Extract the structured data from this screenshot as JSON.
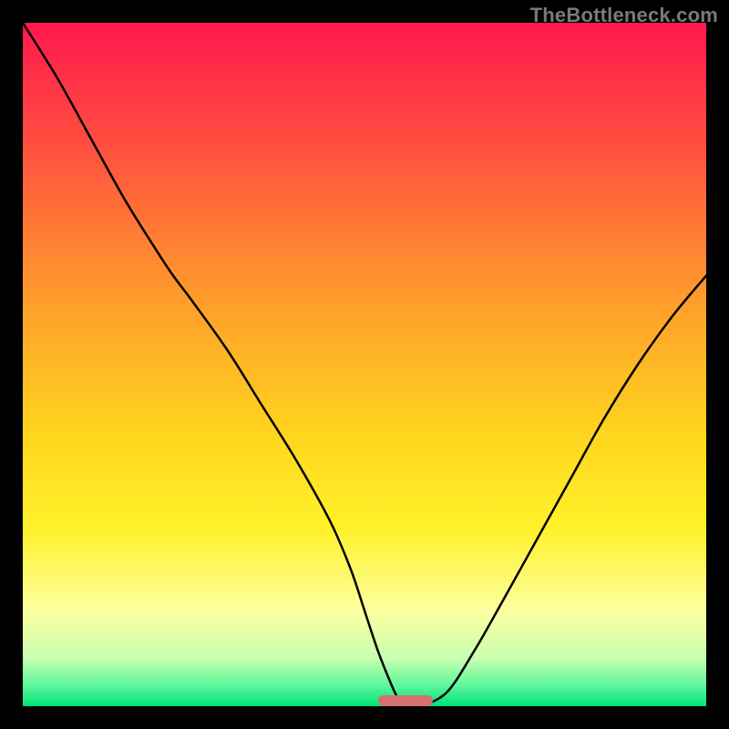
{
  "watermark": "TheBottleneck.com",
  "chart_data": {
    "type": "line",
    "title": "",
    "xlabel": "",
    "ylabel": "",
    "xlim": [
      0,
      100
    ],
    "ylim": [
      0,
      100
    ],
    "grid": false,
    "background_gradient": {
      "stops": [
        {
          "offset": 0,
          "color": "#ff184e"
        },
        {
          "offset": 18,
          "color": "#ff4f3f"
        },
        {
          "offset": 40,
          "color": "#ff9b2c"
        },
        {
          "offset": 60,
          "color": "#ffd41e"
        },
        {
          "offset": 74,
          "color": "#fff22a"
        },
        {
          "offset": 86,
          "color": "#fdffa0"
        },
        {
          "offset": 93,
          "color": "#c9ffb0"
        },
        {
          "offset": 97,
          "color": "#5cf69a"
        },
        {
          "offset": 100,
          "color": "#00e27a"
        }
      ]
    },
    "series": [
      {
        "name": "curve",
        "color": "#000000",
        "width": 2.5,
        "x": [
          0,
          5,
          10,
          15,
          20,
          22,
          25,
          30,
          35,
          40,
          45,
          48,
          50,
          52,
          54,
          55,
          56,
          58,
          62,
          66,
          70,
          75,
          80,
          85,
          90,
          95,
          100
        ],
        "y": [
          100,
          92,
          83,
          74,
          66,
          63,
          59,
          52,
          44,
          36,
          27,
          20,
          14,
          8,
          3,
          1,
          0,
          0,
          2,
          8,
          15,
          24,
          33,
          42,
          50,
          57,
          63
        ]
      }
    ],
    "marker": {
      "name": "min-marker",
      "shape": "rounded-bar",
      "color": "#d47070",
      "x_range": [
        52,
        60
      ],
      "y": 0,
      "height_pct": 1.6
    }
  }
}
